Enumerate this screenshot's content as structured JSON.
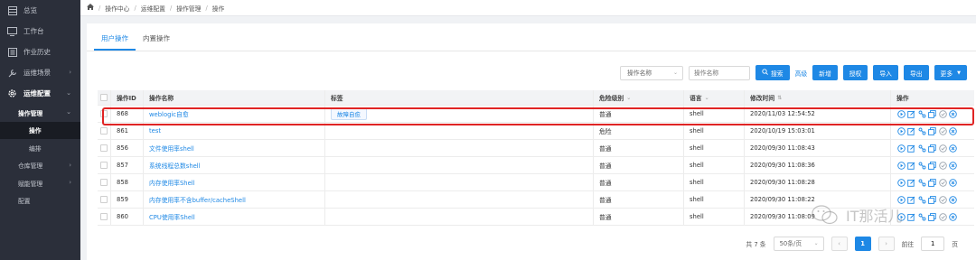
{
  "sidebar": {
    "items": [
      {
        "label": "总览",
        "icon": "dashboard-icon"
      },
      {
        "label": "工作台",
        "icon": "monitor-icon"
      },
      {
        "label": "作业历史",
        "icon": "history-icon"
      },
      {
        "label": "运维场景",
        "icon": "wrench-icon"
      },
      {
        "label": "运维配置",
        "icon": "gear-icon"
      }
    ],
    "sub": {
      "ops_mgmt": "操作管理",
      "ops": "操作",
      "orchestrate": "编排",
      "repo_mgmt": "仓库管理",
      "capability_mgmt": "赋能管理",
      "config": "配置"
    }
  },
  "breadcrumb": [
    "操作中心",
    "运维配置",
    "操作管理",
    "操作"
  ],
  "tabs": [
    "用户操作",
    "内置操作"
  ],
  "toolbar": {
    "filter_select": "操作名称",
    "search_placeholder": "操作名称",
    "search_btn": "搜索",
    "advanced": "高级",
    "add_btn": "新增",
    "auth_btn": "授权",
    "import_btn": "导入",
    "export_btn": "导出",
    "more_btn": "更多"
  },
  "table": {
    "headers": {
      "id": "操作ID",
      "name": "操作名称",
      "tag": "标签",
      "level": "危险级别",
      "lang": "语言",
      "time": "修改时间",
      "ops": "操作"
    },
    "rows": [
      {
        "id": "868",
        "name": "weblogic自愈",
        "tag": "故障自愈",
        "level": "普通",
        "lang": "shell",
        "time": "2020/11/03 12:54:52"
      },
      {
        "id": "861",
        "name": "test",
        "tag": "",
        "level": "危险",
        "lang": "shell",
        "time": "2020/10/19 15:03:01"
      },
      {
        "id": "856",
        "name": "文件使用率shell",
        "tag": "",
        "level": "普通",
        "lang": "shell",
        "time": "2020/09/30 11:08:43"
      },
      {
        "id": "857",
        "name": "系统线程总数shell",
        "tag": "",
        "level": "普通",
        "lang": "shell",
        "time": "2020/09/30 11:08:36"
      },
      {
        "id": "858",
        "name": "内存使用率Shell",
        "tag": "",
        "level": "普通",
        "lang": "shell",
        "time": "2020/09/30 11:08:28"
      },
      {
        "id": "859",
        "name": "内存使用率不含buffer/cacheShell",
        "tag": "",
        "level": "普通",
        "lang": "shell",
        "time": "2020/09/30 11:08:22"
      },
      {
        "id": "860",
        "name": "CPU使用率Shell",
        "tag": "",
        "level": "普通",
        "lang": "shell",
        "time": "2020/09/30 11:08:09"
      }
    ]
  },
  "pager": {
    "total": "共 7 条",
    "page_size": "50条/页",
    "current": "1",
    "goto_label": "前往",
    "goto_value": "1",
    "page_unit": "页"
  },
  "watermark": "IT那活儿",
  "colors": {
    "accent": "#1e88e5",
    "sidebar": "#2b2f3a",
    "highlight": "#e02424"
  }
}
